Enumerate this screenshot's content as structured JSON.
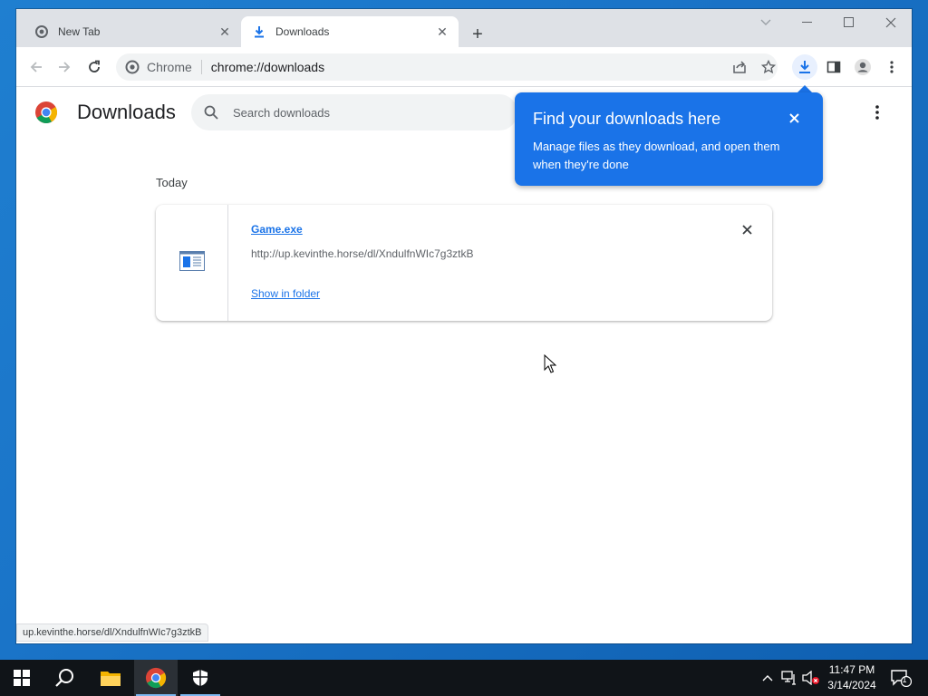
{
  "tabs": [
    {
      "label": "New Tab",
      "active": false
    },
    {
      "label": "Downloads",
      "active": true
    }
  ],
  "toolbar": {
    "omnibox_chip": "Chrome",
    "url": "chrome://downloads"
  },
  "page": {
    "title": "Downloads",
    "search_placeholder": "Search downloads",
    "section_date": "Today"
  },
  "download_item": {
    "filename": "Game.exe",
    "url": "http://up.kevinthe.horse/dl/XndulfnWIc7g3ztkB",
    "show_in_folder": "Show in folder"
  },
  "promo_bubble": {
    "title": "Find your downloads here",
    "body": "Manage files as they download, and open them when they're done"
  },
  "status_bar": {
    "text": "up.kevinthe.horse/dl/XndulfnWIc7g3ztkB"
  },
  "taskbar": {
    "time": "11:47 PM",
    "date": "3/14/2024",
    "notification_count": "1"
  },
  "colors": {
    "accent": "#1a73e8",
    "desktop": "#1a74c8",
    "taskbar": "#101418"
  }
}
